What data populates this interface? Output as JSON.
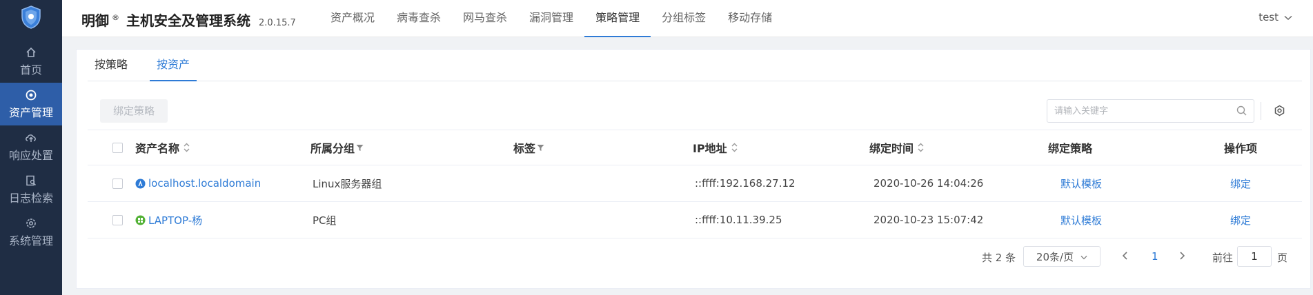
{
  "sidebar": {
    "logo_icon": "shield-logo-icon",
    "items": [
      {
        "label": "首页",
        "icon": "home-icon"
      },
      {
        "label": "资产管理",
        "icon": "asset-icon",
        "active": true
      },
      {
        "label": "响应处置",
        "icon": "cloud-upload-icon"
      },
      {
        "label": "日志检索",
        "icon": "log-search-icon"
      },
      {
        "label": "系统管理",
        "icon": "settings-icon"
      }
    ]
  },
  "header": {
    "brand": "明御",
    "reg": "®",
    "system": "主机安全及管理系统",
    "version": "2.0.15.7",
    "tabs": [
      {
        "label": "资产概况"
      },
      {
        "label": "病毒查杀"
      },
      {
        "label": "网马查杀"
      },
      {
        "label": "漏洞管理"
      },
      {
        "label": "策略管理",
        "active": true
      },
      {
        "label": "分组标签"
      },
      {
        "label": "移动存储"
      }
    ],
    "user": "test"
  },
  "subtabs": [
    {
      "label": "按策略"
    },
    {
      "label": "按资产",
      "active": true
    }
  ],
  "toolbar": {
    "bind_label": "绑定策略",
    "search_placeholder": "请输入关键字"
  },
  "table": {
    "columns": {
      "name": "资产名称",
      "group": "所属分组",
      "tag": "标签",
      "ip": "IP地址",
      "time": "绑定时间",
      "policy": "绑定策略",
      "op": "操作项"
    },
    "rows": [
      {
        "os": "linux",
        "name": "localhost.localdomain",
        "group": "Linux服务器组",
        "tag": "",
        "ip": "::ffff:192.168.27.12",
        "time": "2020-10-26 14:04:26",
        "policy": "默认模板",
        "op": "绑定"
      },
      {
        "os": "windows",
        "name": "LAPTOP-杨",
        "group": "PC组",
        "tag": "",
        "ip": "::ffff:10.11.39.25",
        "time": "2020-10-23 15:07:42",
        "policy": "默认模板",
        "op": "绑定"
      }
    ]
  },
  "pagination": {
    "total": "共 2 条",
    "page_size": "20条/页",
    "current": "1",
    "goto_label": "前往",
    "goto_value": "1",
    "page_unit": "页"
  },
  "colors": {
    "sidebar_bg": "#1f2d44",
    "sidebar_active": "#2e5ea8",
    "accent": "#2e7bd6",
    "linux_icon": "#2e7bd6",
    "windows_icon": "#52b135"
  }
}
